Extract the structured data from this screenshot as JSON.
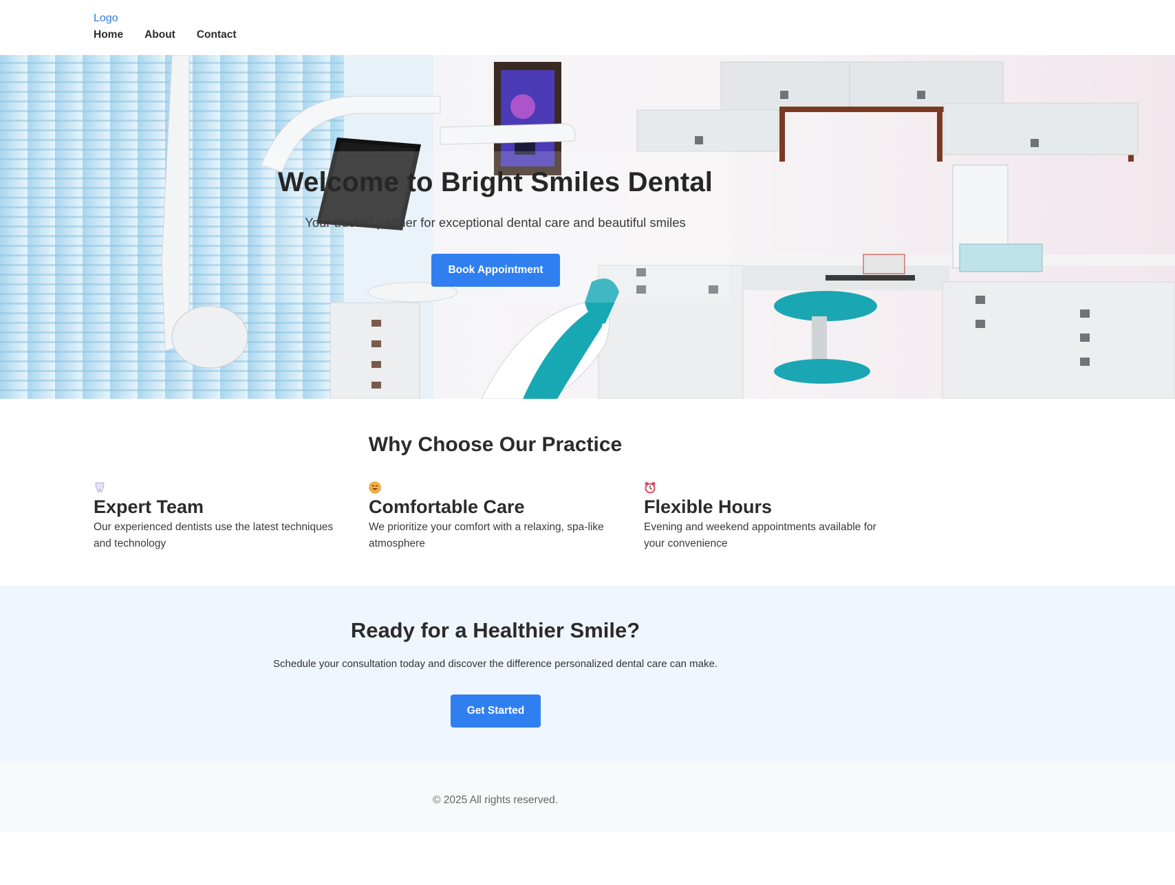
{
  "header": {
    "logo": "Logo",
    "nav": [
      "Home",
      "About",
      "Contact"
    ]
  },
  "hero": {
    "title": "Welcome to Bright Smiles Dental",
    "subtitle": "Your trusted partner for exceptional dental care and beautiful smiles",
    "button": "Book Appointment"
  },
  "features": {
    "heading": "Why Choose Our Practice",
    "items": [
      {
        "icon": "tooth-icon",
        "title": "Expert Team",
        "text": "Our experienced dentists use the latest techniques and technology"
      },
      {
        "icon": "smile-icon",
        "title": "Comfortable Care",
        "text": "We prioritize your comfort with a relaxing, spa-like atmosphere"
      },
      {
        "icon": "alarm-clock-icon",
        "title": "Flexible Hours",
        "text": "Evening and weekend appointments available for your convenience"
      }
    ]
  },
  "cta": {
    "heading": "Ready for a Healthier Smile?",
    "text": "Schedule your consultation today and discover the difference personalized dental care can make.",
    "button": "Get Started"
  },
  "footer": {
    "copyright": "© 2025 All rights reserved."
  },
  "colors": {
    "accent": "#2f7ff0",
    "link": "#2f7be0",
    "cta_bg": "#f0f6fd",
    "footer_bg": "#f8f9fa"
  }
}
